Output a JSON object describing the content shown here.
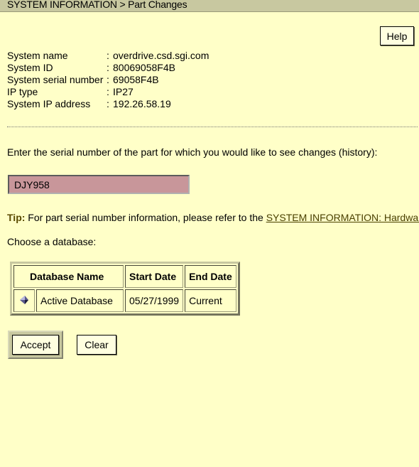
{
  "titlebar": {
    "title": "SYSTEM INFORMATION > Part Changes"
  },
  "help_label": "Help",
  "system_info": [
    {
      "key": "System name",
      "sep": ":",
      "value": "overdrive.csd.sgi.com"
    },
    {
      "key": "System ID",
      "sep": ":",
      "value": "80069058F4B"
    },
    {
      "key": "System serial number",
      "sep": ":",
      "value": "69058F4B"
    },
    {
      "key": "IP type",
      "sep": ":",
      "value": "IP27"
    },
    {
      "key": "System IP address",
      "sep": ":",
      "value": "192.26.58.19"
    }
  ],
  "prompt": "Enter the serial number of the part for which you would like to see changes (history):",
  "serial_input": {
    "value": "DJY958"
  },
  "tip": {
    "label": "Tip:",
    "text": " For part serial number information, please refer to the ",
    "link": "SYSTEM INFORMATION: Hardware",
    "end": "."
  },
  "choose_label": "Choose a database:",
  "db_table": {
    "headers": [
      "Database Name",
      "Start Date",
      "End Date"
    ],
    "rows": [
      {
        "name": "Active Database",
        "start": "05/27/1999",
        "end": "Current"
      }
    ]
  },
  "buttons": {
    "accept": "Accept",
    "clear": "Clear"
  },
  "colors": {
    "background": "#ffffc8",
    "input_bg": "#c8969a",
    "titlebar_bg": "#c8c8a0"
  }
}
